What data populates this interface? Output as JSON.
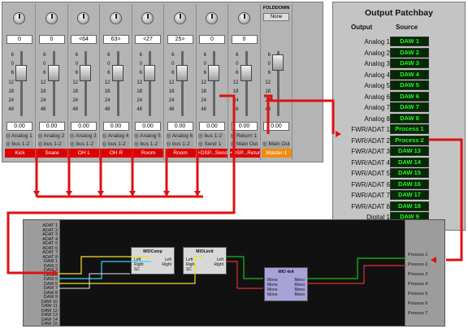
{
  "mixer": {
    "scale": [
      "6",
      "0",
      "6",
      "12",
      "18",
      "24",
      "48"
    ],
    "channels": [
      {
        "pan": "0",
        "value": "0.00",
        "input": "Analog 1",
        "output": "bus 1-2",
        "name": "Kick"
      },
      {
        "pan": "0",
        "value": "0.00",
        "input": "Analog 2",
        "output": "bus 1-2",
        "name": "Snare"
      },
      {
        "pan": "<64",
        "value": "0.00",
        "input": "Analog 3",
        "output": "bus 1-2",
        "name": "OH L"
      },
      {
        "pan": "63>",
        "value": "0.00",
        "input": "Analog 4",
        "output": "bus 1-2",
        "name": "OH R"
      },
      {
        "pan": "<27",
        "value": "0.00",
        "input": "Analog 5",
        "output": "bus 1-2",
        "name": "Room"
      },
      {
        "pan": "25>",
        "value": "0.00",
        "input": "Analog 6",
        "output": "bus 1-2",
        "name": "Room"
      },
      {
        "pan": "0",
        "value": "0.00",
        "input": "bus 1-2",
        "output": "Send 1",
        "name": "+DSP...Send"
      },
      {
        "pan": "0",
        "value": "0.00",
        "input": "Return 1",
        "output": "Main Out",
        "name": "+DSP...Return"
      },
      {
        "pan": "",
        "value": "0.00",
        "input": "",
        "output": "Main Out",
        "name": "Master-1"
      }
    ],
    "folddown_label": "FOLDDOWN",
    "folddown_value": "None"
  },
  "patchbay": {
    "title": "Output Patchbay",
    "col_output": "Output",
    "col_source": "Source",
    "rows": [
      {
        "output": "Analog 1",
        "source": "DAW 1"
      },
      {
        "output": "Analog 2",
        "source": "DAW 2"
      },
      {
        "output": "Analog 3",
        "source": "DAW 3"
      },
      {
        "output": "Analog 4",
        "source": "DAW 4"
      },
      {
        "output": "Analog 5",
        "source": "DAW 5"
      },
      {
        "output": "Analog 6",
        "source": "DAW 6"
      },
      {
        "output": "Analog 7",
        "source": "DAW 7"
      },
      {
        "output": "Analog 8",
        "source": "DAW 8"
      },
      {
        "output": "FWR/ADAT 1",
        "source": "Process 1"
      },
      {
        "output": "FWR/ADAT 2",
        "source": "Process 2"
      },
      {
        "output": "FWR/ADAT 3",
        "source": "DAW 13"
      },
      {
        "output": "FWR/ADAT 4",
        "source": "DAW 14"
      },
      {
        "output": "FWR/ADAT 5",
        "source": "DAW 15"
      },
      {
        "output": "FWR/ADAT 6",
        "source": "DAW 16"
      },
      {
        "output": "FWR/ADAT 7",
        "source": "DAW 17"
      },
      {
        "output": "FWR/ADAT 8",
        "source": "DAW 18"
      },
      {
        "output": "Digital 1",
        "source": "DAW 9"
      }
    ]
  },
  "router": {
    "inputs": [
      "ADAT 1",
      "ADAT 2",
      "ADAT 3",
      "ADAT 4",
      "ADAT 5",
      "ADAT 6",
      "ADAT 7",
      "ADAT 8",
      "DAW 1",
      "DAW 2",
      "DAW 3",
      "DAW 4",
      "DAW 5",
      "DAW 6",
      "DAW 7",
      "DAW 8",
      "DAW 9",
      "DAW 10",
      "DAW 11",
      "DAW 12",
      "DAW 13",
      "DAW 14",
      "DAW 15"
    ],
    "outputs": [
      "Process 1",
      "Process 2",
      "Process 3",
      "Process 4",
      "Process 5",
      "Process 6",
      "Process 7"
    ],
    "plugins": {
      "miocomp": {
        "title": "MIOComp",
        "ports": [
          "Left",
          "Right",
          "SC"
        ],
        "outs": [
          "Left",
          "Right"
        ]
      },
      "miolimit": {
        "title": "MIOLimit",
        "ports": [
          "Left",
          "Right",
          "SC"
        ],
        "outs": [
          "Left",
          "Right"
        ]
      },
      "mio4x4": {
        "title": "MIO 4x4",
        "ins": [
          "Mono",
          "Mono",
          "Mono",
          "Mono"
        ],
        "outs": [
          "Mono",
          "Mono",
          "Mono",
          "Mono"
        ]
      }
    }
  },
  "colors": {
    "wire_red": "#e01010",
    "wire_yellow": "#f0e020",
    "wire_cyan": "#30d8f0",
    "wire_green": "#18c018",
    "wire_purple": "#7a6acc"
  }
}
